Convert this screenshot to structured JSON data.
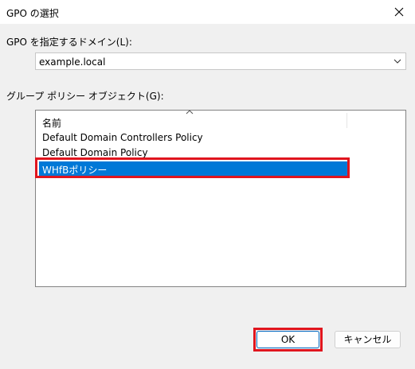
{
  "window": {
    "title": "GPO の選択"
  },
  "domain": {
    "label": "GPO を指定するドメイン(L):",
    "value": "example.local"
  },
  "gpo_list": {
    "label": "グループ ポリシー オブジェクト(G):",
    "column_header": "名前",
    "items": [
      "Default Domain Controllers Policy",
      "Default Domain Policy",
      "WHfBポリシー"
    ],
    "selected_index": 2
  },
  "buttons": {
    "ok": "OK",
    "cancel": "キャンセル"
  },
  "colors": {
    "selection": "#0078d7",
    "highlight_box": "#e0151e"
  }
}
